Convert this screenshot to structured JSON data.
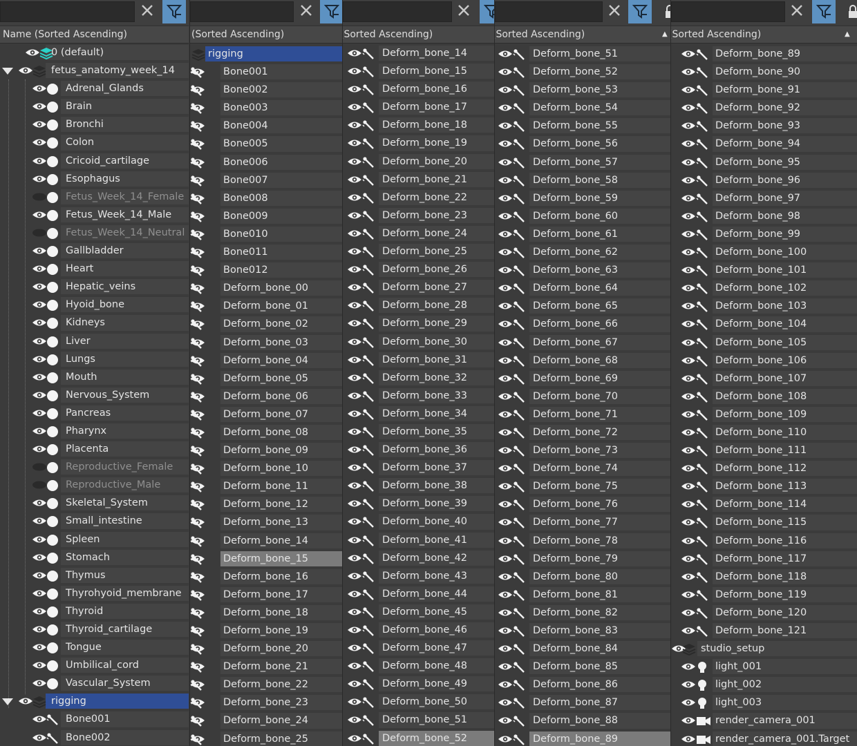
{
  "colors": {
    "background": "#3b3b3b",
    "row_highlight": "#444444",
    "selected": "#2f4e96",
    "filter_button": "#5d92c2"
  },
  "panels": [
    {
      "header": "Name (Sorted Ascending)",
      "rows": [
        {
          "name": "0 (default)",
          "icon": "layer-icon-active",
          "level": 1
        },
        {
          "name": "fetus_anatomy_week_14",
          "icon": "layer-icon",
          "level": 0,
          "expanded": true
        },
        {
          "name": "Adrenal_Glands",
          "icon": "sphere-icon",
          "level": 2
        },
        {
          "name": "Brain",
          "icon": "sphere-icon",
          "level": 2
        },
        {
          "name": "Bronchi",
          "icon": "sphere-icon",
          "level": 2
        },
        {
          "name": "Colon",
          "icon": "sphere-icon",
          "level": 2
        },
        {
          "name": "Cricoid_cartilage",
          "icon": "sphere-icon",
          "level": 2
        },
        {
          "name": "Esophagus",
          "icon": "sphere-icon",
          "level": 2
        },
        {
          "name": "Fetus_Week_14_Female",
          "icon": "sphere-icon",
          "level": 2,
          "hidden": true
        },
        {
          "name": "Fetus_Week_14_Male",
          "icon": "sphere-icon",
          "level": 2
        },
        {
          "name": "Fetus_Week_14_Neutral",
          "icon": "sphere-icon",
          "level": 2,
          "hidden": true
        },
        {
          "name": "Gallbladder",
          "icon": "sphere-icon",
          "level": 2
        },
        {
          "name": "Heart",
          "icon": "sphere-icon",
          "level": 2
        },
        {
          "name": "Hepatic_veins",
          "icon": "sphere-icon",
          "level": 2
        },
        {
          "name": "Hyoid_bone",
          "icon": "sphere-icon",
          "level": 2
        },
        {
          "name": "Kidneys",
          "icon": "sphere-icon",
          "level": 2
        },
        {
          "name": "Liver",
          "icon": "sphere-icon",
          "level": 2
        },
        {
          "name": "Lungs",
          "icon": "sphere-icon",
          "level": 2
        },
        {
          "name": "Mouth",
          "icon": "sphere-icon",
          "level": 2
        },
        {
          "name": "Nervous_System",
          "icon": "sphere-icon",
          "level": 2
        },
        {
          "name": "Pancreas",
          "icon": "sphere-icon",
          "level": 2
        },
        {
          "name": "Pharynx",
          "icon": "sphere-icon",
          "level": 2
        },
        {
          "name": "Placenta",
          "icon": "sphere-icon",
          "level": 2
        },
        {
          "name": "Reproductive_Female",
          "icon": "sphere-icon",
          "level": 2,
          "hidden": true
        },
        {
          "name": "Reproductive_Male",
          "icon": "sphere-icon",
          "level": 2,
          "hidden": true
        },
        {
          "name": "Skeletal_System",
          "icon": "sphere-icon",
          "level": 2
        },
        {
          "name": "Small_intestine",
          "icon": "sphere-icon",
          "level": 2
        },
        {
          "name": "Spleen",
          "icon": "sphere-icon",
          "level": 2
        },
        {
          "name": "Stomach",
          "icon": "sphere-icon",
          "level": 2
        },
        {
          "name": "Thymus",
          "icon": "sphere-icon",
          "level": 2
        },
        {
          "name": "Thyrohyoid_membrane",
          "icon": "sphere-icon",
          "level": 2
        },
        {
          "name": "Thyroid",
          "icon": "sphere-icon",
          "level": 2
        },
        {
          "name": "Thyroid_cartilage",
          "icon": "sphere-icon",
          "level": 2
        },
        {
          "name": "Tongue",
          "icon": "sphere-icon",
          "level": 2
        },
        {
          "name": "Umbilical_cord",
          "icon": "sphere-icon",
          "level": 2
        },
        {
          "name": "Vascular_System",
          "icon": "sphere-icon",
          "level": 2
        },
        {
          "name": "rigging",
          "icon": "layer-icon",
          "level": 0,
          "expanded": true,
          "selected": true
        },
        {
          "name": "Bone001",
          "icon": "bone-icon",
          "level": 2
        },
        {
          "name": "Bone002",
          "icon": "bone-icon",
          "level": 2
        }
      ]
    },
    {
      "header": "(Sorted Ascending)",
      "rows": [
        {
          "name": "rigging",
          "icon": "layer-icon",
          "level": 0,
          "selected": true,
          "noeye": true
        },
        {
          "name": "Bone001",
          "icon": "bone-icon"
        },
        {
          "name": "Bone002",
          "icon": "bone-icon"
        },
        {
          "name": "Bone003",
          "icon": "bone-icon"
        },
        {
          "name": "Bone004",
          "icon": "bone-icon"
        },
        {
          "name": "Bone005",
          "icon": "bone-icon"
        },
        {
          "name": "Bone006",
          "icon": "bone-icon"
        },
        {
          "name": "Bone007",
          "icon": "bone-icon"
        },
        {
          "name": "Bone008",
          "icon": "bone-icon"
        },
        {
          "name": "Bone009",
          "icon": "bone-icon"
        },
        {
          "name": "Bone010",
          "icon": "bone-icon"
        },
        {
          "name": "Bone011",
          "icon": "bone-icon"
        },
        {
          "name": "Bone012",
          "icon": "bone-icon"
        },
        {
          "name": "Deform_bone_00",
          "icon": "bone-icon"
        },
        {
          "name": "Deform_bone_01",
          "icon": "bone-icon"
        },
        {
          "name": "Deform_bone_02",
          "icon": "bone-icon"
        },
        {
          "name": "Deform_bone_03",
          "icon": "bone-icon"
        },
        {
          "name": "Deform_bone_04",
          "icon": "bone-icon"
        },
        {
          "name": "Deform_bone_05",
          "icon": "bone-icon"
        },
        {
          "name": "Deform_bone_06",
          "icon": "bone-icon"
        },
        {
          "name": "Deform_bone_07",
          "icon": "bone-icon"
        },
        {
          "name": "Deform_bone_08",
          "icon": "bone-icon"
        },
        {
          "name": "Deform_bone_09",
          "icon": "bone-icon"
        },
        {
          "name": "Deform_bone_10",
          "icon": "bone-icon"
        },
        {
          "name": "Deform_bone_11",
          "icon": "bone-icon"
        },
        {
          "name": "Deform_bone_12",
          "icon": "bone-icon"
        },
        {
          "name": "Deform_bone_13",
          "icon": "bone-icon"
        },
        {
          "name": "Deform_bone_14",
          "icon": "bone-icon"
        },
        {
          "name": "Deform_bone_15",
          "icon": "bone-icon",
          "grey": true
        },
        {
          "name": "Deform_bone_16",
          "icon": "bone-icon"
        },
        {
          "name": "Deform_bone_17",
          "icon": "bone-icon"
        },
        {
          "name": "Deform_bone_18",
          "icon": "bone-icon"
        },
        {
          "name": "Deform_bone_19",
          "icon": "bone-icon"
        },
        {
          "name": "Deform_bone_20",
          "icon": "bone-icon"
        },
        {
          "name": "Deform_bone_21",
          "icon": "bone-icon"
        },
        {
          "name": "Deform_bone_22",
          "icon": "bone-icon"
        },
        {
          "name": "Deform_bone_23",
          "icon": "bone-icon"
        },
        {
          "name": "Deform_bone_24",
          "icon": "bone-icon"
        },
        {
          "name": "Deform_bone_25",
          "icon": "bone-icon"
        }
      ]
    },
    {
      "header": "(Sorted Ascending)",
      "rows": [
        {
          "name": "Deform_bone_14",
          "icon": "bone-icon"
        },
        {
          "name": "Deform_bone_15",
          "icon": "bone-icon"
        },
        {
          "name": "Deform_bone_16",
          "icon": "bone-icon"
        },
        {
          "name": "Deform_bone_17",
          "icon": "bone-icon"
        },
        {
          "name": "Deform_bone_18",
          "icon": "bone-icon"
        },
        {
          "name": "Deform_bone_19",
          "icon": "bone-icon"
        },
        {
          "name": "Deform_bone_20",
          "icon": "bone-icon"
        },
        {
          "name": "Deform_bone_21",
          "icon": "bone-icon"
        },
        {
          "name": "Deform_bone_22",
          "icon": "bone-icon"
        },
        {
          "name": "Deform_bone_23",
          "icon": "bone-icon"
        },
        {
          "name": "Deform_bone_24",
          "icon": "bone-icon"
        },
        {
          "name": "Deform_bone_25",
          "icon": "bone-icon"
        },
        {
          "name": "Deform_bone_26",
          "icon": "bone-icon"
        },
        {
          "name": "Deform_bone_27",
          "icon": "bone-icon"
        },
        {
          "name": "Deform_bone_28",
          "icon": "bone-icon"
        },
        {
          "name": "Deform_bone_29",
          "icon": "bone-icon"
        },
        {
          "name": "Deform_bone_30",
          "icon": "bone-icon"
        },
        {
          "name": "Deform_bone_31",
          "icon": "bone-icon"
        },
        {
          "name": "Deform_bone_32",
          "icon": "bone-icon"
        },
        {
          "name": "Deform_bone_33",
          "icon": "bone-icon"
        },
        {
          "name": "Deform_bone_34",
          "icon": "bone-icon"
        },
        {
          "name": "Deform_bone_35",
          "icon": "bone-icon"
        },
        {
          "name": "Deform_bone_36",
          "icon": "bone-icon"
        },
        {
          "name": "Deform_bone_37",
          "icon": "bone-icon"
        },
        {
          "name": "Deform_bone_38",
          "icon": "bone-icon"
        },
        {
          "name": "Deform_bone_39",
          "icon": "bone-icon"
        },
        {
          "name": "Deform_bone_40",
          "icon": "bone-icon"
        },
        {
          "name": "Deform_bone_41",
          "icon": "bone-icon"
        },
        {
          "name": "Deform_bone_42",
          "icon": "bone-icon"
        },
        {
          "name": "Deform_bone_43",
          "icon": "bone-icon"
        },
        {
          "name": "Deform_bone_44",
          "icon": "bone-icon"
        },
        {
          "name": "Deform_bone_45",
          "icon": "bone-icon"
        },
        {
          "name": "Deform_bone_46",
          "icon": "bone-icon"
        },
        {
          "name": "Deform_bone_47",
          "icon": "bone-icon"
        },
        {
          "name": "Deform_bone_48",
          "icon": "bone-icon"
        },
        {
          "name": "Deform_bone_49",
          "icon": "bone-icon"
        },
        {
          "name": "Deform_bone_50",
          "icon": "bone-icon"
        },
        {
          "name": "Deform_bone_51",
          "icon": "bone-icon"
        },
        {
          "name": "Deform_bone_52",
          "icon": "bone-icon",
          "grey": true
        }
      ]
    },
    {
      "header": "(Sorted Ascending)",
      "rows": [
        {
          "name": "Deform_bone_51",
          "icon": "bone-icon"
        },
        {
          "name": "Deform_bone_52",
          "icon": "bone-icon"
        },
        {
          "name": "Deform_bone_53",
          "icon": "bone-icon"
        },
        {
          "name": "Deform_bone_54",
          "icon": "bone-icon"
        },
        {
          "name": "Deform_bone_55",
          "icon": "bone-icon"
        },
        {
          "name": "Deform_bone_56",
          "icon": "bone-icon"
        },
        {
          "name": "Deform_bone_57",
          "icon": "bone-icon"
        },
        {
          "name": "Deform_bone_58",
          "icon": "bone-icon"
        },
        {
          "name": "Deform_bone_59",
          "icon": "bone-icon"
        },
        {
          "name": "Deform_bone_60",
          "icon": "bone-icon"
        },
        {
          "name": "Deform_bone_61",
          "icon": "bone-icon"
        },
        {
          "name": "Deform_bone_62",
          "icon": "bone-icon"
        },
        {
          "name": "Deform_bone_63",
          "icon": "bone-icon"
        },
        {
          "name": "Deform_bone_64",
          "icon": "bone-icon"
        },
        {
          "name": "Deform_bone_65",
          "icon": "bone-icon"
        },
        {
          "name": "Deform_bone_66",
          "icon": "bone-icon"
        },
        {
          "name": "Deform_bone_67",
          "icon": "bone-icon"
        },
        {
          "name": "Deform_bone_68",
          "icon": "bone-icon"
        },
        {
          "name": "Deform_bone_69",
          "icon": "bone-icon"
        },
        {
          "name": "Deform_bone_70",
          "icon": "bone-icon"
        },
        {
          "name": "Deform_bone_71",
          "icon": "bone-icon"
        },
        {
          "name": "Deform_bone_72",
          "icon": "bone-icon"
        },
        {
          "name": "Deform_bone_73",
          "icon": "bone-icon"
        },
        {
          "name": "Deform_bone_74",
          "icon": "bone-icon"
        },
        {
          "name": "Deform_bone_75",
          "icon": "bone-icon"
        },
        {
          "name": "Deform_bone_76",
          "icon": "bone-icon"
        },
        {
          "name": "Deform_bone_77",
          "icon": "bone-icon"
        },
        {
          "name": "Deform_bone_78",
          "icon": "bone-icon"
        },
        {
          "name": "Deform_bone_79",
          "icon": "bone-icon"
        },
        {
          "name": "Deform_bone_80",
          "icon": "bone-icon"
        },
        {
          "name": "Deform_bone_81",
          "icon": "bone-icon"
        },
        {
          "name": "Deform_bone_82",
          "icon": "bone-icon"
        },
        {
          "name": "Deform_bone_83",
          "icon": "bone-icon"
        },
        {
          "name": "Deform_bone_84",
          "icon": "bone-icon"
        },
        {
          "name": "Deform_bone_85",
          "icon": "bone-icon"
        },
        {
          "name": "Deform_bone_86",
          "icon": "bone-icon"
        },
        {
          "name": "Deform_bone_87",
          "icon": "bone-icon"
        },
        {
          "name": "Deform_bone_88",
          "icon": "bone-icon"
        },
        {
          "name": "Deform_bone_89",
          "icon": "bone-icon",
          "grey": true
        }
      ]
    },
    {
      "header": "(Sorted Ascending)",
      "rows": [
        {
          "name": "Deform_bone_89",
          "icon": "bone-icon"
        },
        {
          "name": "Deform_bone_90",
          "icon": "bone-icon"
        },
        {
          "name": "Deform_bone_91",
          "icon": "bone-icon"
        },
        {
          "name": "Deform_bone_92",
          "icon": "bone-icon"
        },
        {
          "name": "Deform_bone_93",
          "icon": "bone-icon"
        },
        {
          "name": "Deform_bone_94",
          "icon": "bone-icon"
        },
        {
          "name": "Deform_bone_95",
          "icon": "bone-icon"
        },
        {
          "name": "Deform_bone_96",
          "icon": "bone-icon"
        },
        {
          "name": "Deform_bone_97",
          "icon": "bone-icon"
        },
        {
          "name": "Deform_bone_98",
          "icon": "bone-icon"
        },
        {
          "name": "Deform_bone_99",
          "icon": "bone-icon"
        },
        {
          "name": "Deform_bone_100",
          "icon": "bone-icon"
        },
        {
          "name": "Deform_bone_101",
          "icon": "bone-icon"
        },
        {
          "name": "Deform_bone_102",
          "icon": "bone-icon"
        },
        {
          "name": "Deform_bone_103",
          "icon": "bone-icon"
        },
        {
          "name": "Deform_bone_104",
          "icon": "bone-icon"
        },
        {
          "name": "Deform_bone_105",
          "icon": "bone-icon"
        },
        {
          "name": "Deform_bone_106",
          "icon": "bone-icon"
        },
        {
          "name": "Deform_bone_107",
          "icon": "bone-icon"
        },
        {
          "name": "Deform_bone_108",
          "icon": "bone-icon"
        },
        {
          "name": "Deform_bone_109",
          "icon": "bone-icon"
        },
        {
          "name": "Deform_bone_110",
          "icon": "bone-icon"
        },
        {
          "name": "Deform_bone_111",
          "icon": "bone-icon"
        },
        {
          "name": "Deform_bone_112",
          "icon": "bone-icon"
        },
        {
          "name": "Deform_bone_113",
          "icon": "bone-icon"
        },
        {
          "name": "Deform_bone_114",
          "icon": "bone-icon"
        },
        {
          "name": "Deform_bone_115",
          "icon": "bone-icon"
        },
        {
          "name": "Deform_bone_116",
          "icon": "bone-icon"
        },
        {
          "name": "Deform_bone_117",
          "icon": "bone-icon"
        },
        {
          "name": "Deform_bone_118",
          "icon": "bone-icon"
        },
        {
          "name": "Deform_bone_119",
          "icon": "bone-icon"
        },
        {
          "name": "Deform_bone_120",
          "icon": "bone-icon"
        },
        {
          "name": "Deform_bone_121",
          "icon": "bone-icon"
        },
        {
          "name": "studio_setup",
          "icon": "layer-icon",
          "level": 0
        },
        {
          "name": "light_001",
          "icon": "light-icon"
        },
        {
          "name": "light_002",
          "icon": "light-icon"
        },
        {
          "name": "light_003",
          "icon": "light-icon"
        },
        {
          "name": "render_camera_001",
          "icon": "camera-icon"
        },
        {
          "name": "render_camera_001.Target",
          "icon": "camera-icon"
        }
      ]
    }
  ]
}
